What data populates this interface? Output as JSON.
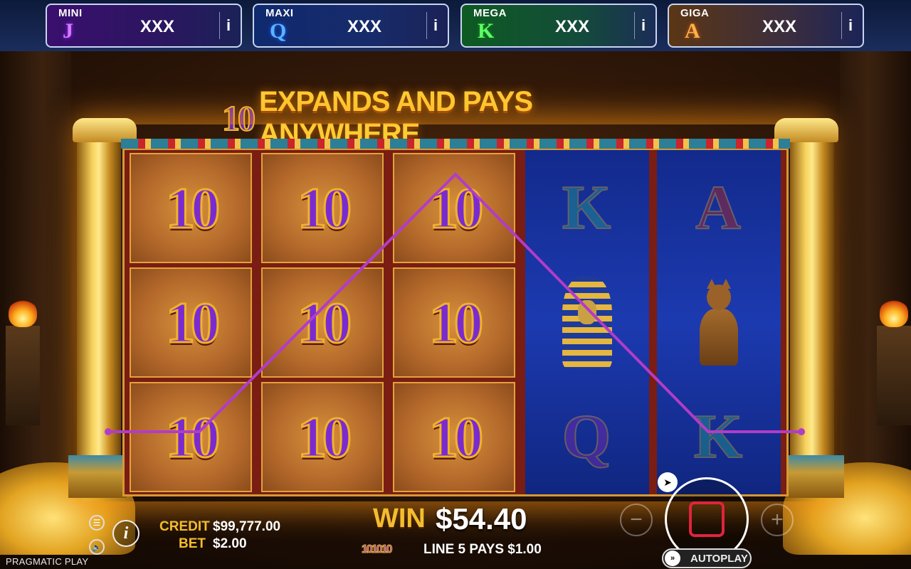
{
  "jackpots": [
    {
      "name": "MINI",
      "letter": "J",
      "value": "XXX",
      "info": "i"
    },
    {
      "name": "MAXI",
      "letter": "Q",
      "value": "XXX",
      "info": "i"
    },
    {
      "name": "MEGA",
      "letter": "K",
      "value": "XXX",
      "info": "i"
    },
    {
      "name": "GIGA",
      "letter": "A",
      "value": "XXX",
      "info": "i"
    }
  ],
  "headline": {
    "symbol": "10",
    "text": "EXPANDS AND PAYS ANYWHERE"
  },
  "reels": {
    "ten_symbol": "10",
    "reel4": [
      "K",
      "pharaoh",
      "Q"
    ],
    "reel5": [
      "A",
      "cat",
      "K"
    ]
  },
  "status": {
    "credit_label": "CREDIT",
    "credit_value": "$99,777.00",
    "bet_label": "BET",
    "bet_value": "$2.00",
    "win_label": "WIN",
    "win_value": "$54.40",
    "line_icons": "101010",
    "line_text": "LINE 5 PAYS $1.00"
  },
  "controls": {
    "menu_icon": "☰",
    "sound_icon": "🔈",
    "info_icon": "i",
    "minus": "−",
    "plus": "+",
    "autoplay_label": "AUTOPLAY",
    "autoplay_icon": "»"
  },
  "brand": "PRAGMATIC PLAY",
  "colors": {
    "payline": "#b23cc8",
    "gold": "#f4bd2c",
    "stop": "#e0243c"
  }
}
